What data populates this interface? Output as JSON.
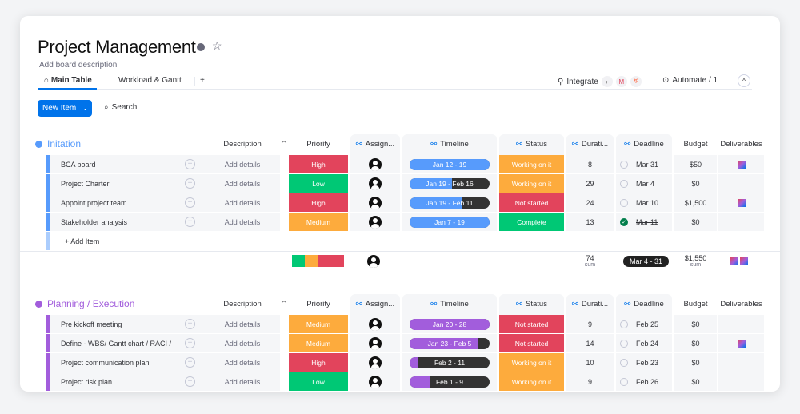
{
  "board": {
    "title": "Project Management",
    "description": "Add board description"
  },
  "tabs": [
    {
      "label": "Main Table",
      "icon": "home-icon"
    },
    {
      "label": "Workload & Gantt"
    },
    {
      "label": "+"
    }
  ],
  "toolbar": {
    "integrate": "Integrate",
    "automate": "Automate / 1",
    "new_item": "New Item",
    "search": "Search"
  },
  "columns": {
    "description": "Description",
    "priority": "Priority",
    "assignee": "Assign...",
    "timeline": "Timeline",
    "status": "Status",
    "duration": "Durati...",
    "deadline": "Deadline",
    "budget": "Budget",
    "deliverables": "Deliverables"
  },
  "colors": {
    "high": "#e2445c",
    "medium": "#fdab3d",
    "low": "#00c875",
    "working": "#fdab3d",
    "not_started": "#e2445c",
    "complete": "#00c875",
    "group1": "#579bfc",
    "group2": "#a25ddc",
    "timeline_remaining": "#333333"
  },
  "groups": [
    {
      "title": "Initation",
      "color": "#579bfc",
      "add_item": "+ Add Item",
      "rows": [
        {
          "name": "BCA board",
          "description": "Add details",
          "priority": "High",
          "priority_color": "#e2445c",
          "timeline": "Jan 12 - 19",
          "timeline_progress": 1.0,
          "status": "Working on it",
          "status_color": "#fdab3d",
          "duration": "8",
          "deadline": "Mar 31",
          "deadline_done": false,
          "budget": "$50",
          "deliverables": 1
        },
        {
          "name": "Project Charter",
          "description": "Add details",
          "priority": "Low",
          "priority_color": "#00c875",
          "timeline": "Jan 19 - Feb 16",
          "timeline_progress": 0.53,
          "status": "Working on it",
          "status_color": "#fdab3d",
          "duration": "29",
          "deadline": "Mar 4",
          "deadline_done": false,
          "budget": "$0",
          "deliverables": 0
        },
        {
          "name": "Appoint project team",
          "description": "Add details",
          "priority": "High",
          "priority_color": "#e2445c",
          "timeline": "Jan 19 - Feb 11",
          "timeline_progress": 0.65,
          "status": "Not started",
          "status_color": "#e2445c",
          "duration": "24",
          "deadline": "Mar 10",
          "deadline_done": false,
          "budget": "$1,500",
          "deliverables": 1
        },
        {
          "name": "Stakeholder analysis",
          "description": "Add details",
          "priority": "Medium",
          "priority_color": "#fdab3d",
          "timeline": "Jan 7 - 19",
          "timeline_progress": 1.0,
          "status": "Complete",
          "status_color": "#00c875",
          "duration": "13",
          "deadline": "Mar 11",
          "deadline_done": true,
          "budget": "$0",
          "deliverables": 0
        }
      ],
      "summary": {
        "duration": "74",
        "duration_label": "sum",
        "deadline": "Mar 4 - 31",
        "budget": "$1,550",
        "budget_label": "sum",
        "priority_distribution": [
          {
            "color": "#00c875",
            "share": 0.25
          },
          {
            "color": "#fdab3d",
            "share": 0.25
          },
          {
            "color": "#e2445c",
            "share": 0.5
          }
        ],
        "deliverables": 2
      }
    },
    {
      "title": "Planning / Execution",
      "color": "#a25ddc",
      "rows": [
        {
          "name": "Pre kickoff meeting",
          "description": "Add details",
          "priority": "Medium",
          "priority_color": "#fdab3d",
          "timeline": "Jan 20 - 28",
          "timeline_progress": 1.0,
          "status": "Not started",
          "status_color": "#e2445c",
          "duration": "9",
          "deadline": "Feb 25",
          "deadline_done": false,
          "budget": "$0",
          "deliverables": 0
        },
        {
          "name": "Define - WBS/ Gantt chart / RACI /",
          "description": "Add details",
          "priority": "Medium",
          "priority_color": "#fdab3d",
          "timeline": "Jan 23 - Feb 5",
          "timeline_progress": 0.85,
          "status": "Not started",
          "status_color": "#e2445c",
          "duration": "14",
          "deadline": "Feb 24",
          "deadline_done": false,
          "budget": "$0",
          "deliverables": 1
        },
        {
          "name": "Project communication plan",
          "description": "Add details",
          "priority": "High",
          "priority_color": "#e2445c",
          "timeline": "Feb 2 - 11",
          "timeline_progress": 0.1,
          "status": "Working on it",
          "status_color": "#fdab3d",
          "duration": "10",
          "deadline": "Feb 23",
          "deadline_done": false,
          "budget": "$0",
          "deliverables": 0
        },
        {
          "name": "Project risk plan",
          "description": "Add details",
          "priority": "Low",
          "priority_color": "#00c875",
          "timeline": "Feb 1 - 9",
          "timeline_progress": 0.25,
          "status": "Working on it",
          "status_color": "#fdab3d",
          "duration": "9",
          "deadline": "Feb 26",
          "deadline_done": false,
          "budget": "$0",
          "deliverables": 0
        }
      ]
    }
  ]
}
